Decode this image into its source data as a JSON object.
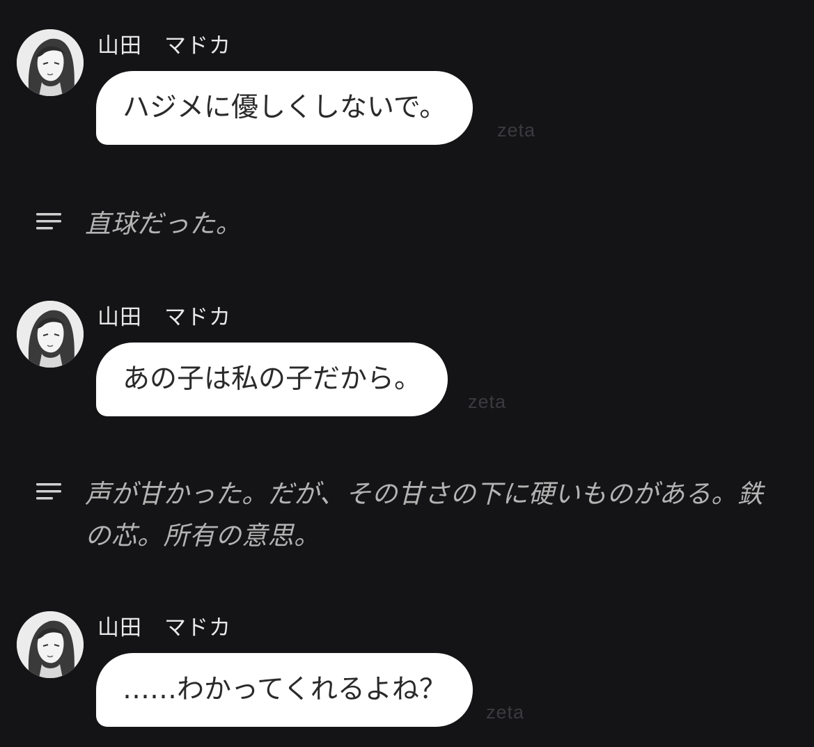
{
  "messages": [
    {
      "speaker": "山田　マドカ",
      "text": "ハジメに優しくしないで。",
      "watermark": "zeta"
    },
    {
      "speaker": "山田　マドカ",
      "text": "あの子は私の子だから。",
      "watermark": "zeta"
    },
    {
      "speaker": "山田　マドカ",
      "text": "……わかってくれるよね？",
      "watermark": "zeta"
    }
  ],
  "narrations": [
    {
      "icon": "narration-lines-icon",
      "text": "直球だった。"
    },
    {
      "icon": "narration-lines-icon",
      "text": "声が甘かった。だが、その甘さの下に硬いものがある。鉄の芯。所有の意思。"
    }
  ],
  "colors": {
    "background": "#141416",
    "bubble": "#ffffff",
    "bubble_text": "#2a2a2a",
    "narration_text": "#b3b3b3",
    "watermark": "#3b3b3f"
  }
}
